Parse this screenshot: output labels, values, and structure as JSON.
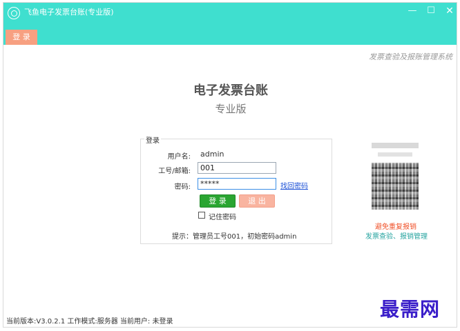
{
  "window": {
    "title": "飞鱼电子发票台账(专业版)",
    "accent_color": "#3fdfcf",
    "controls": {
      "minimize": "—",
      "maximize": "☐",
      "close": "✕"
    }
  },
  "tabs": {
    "login": "登 录"
  },
  "tagline": "发票查验及报账管理系统",
  "header": {
    "title": "电子发票台账",
    "subtitle": "专业版"
  },
  "login_form": {
    "legend": "登录",
    "username_label": "用户名:",
    "username_value": "admin",
    "workid_label": "工号/邮箱:",
    "workid_value": "001",
    "password_label": "密码:",
    "password_value": "*****",
    "forgot_link": "找回密码",
    "login_button": "登 录",
    "exit_button": "退 出",
    "remember_label": "记住密码",
    "remember_checked": false,
    "hint": "提示：管理员工号001，初始密码admin"
  },
  "qr_panel": {
    "warning": "避免重复报销",
    "subtext": "发票查验、报销管理"
  },
  "statusbar": {
    "text": "当前版本:V3.0.2.1  工作模式:服务器  当前用户: 未登录"
  },
  "watermark": "最需网"
}
